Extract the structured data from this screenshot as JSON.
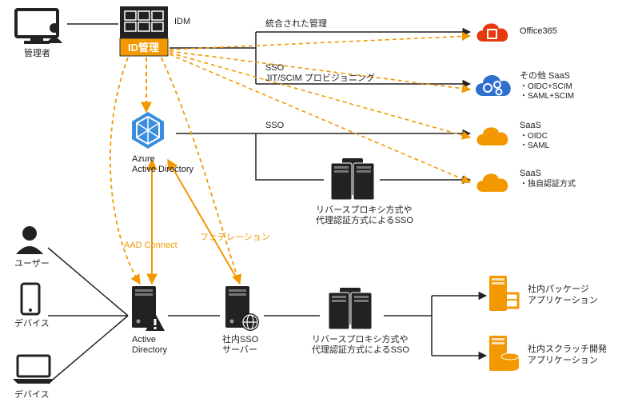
{
  "title": "IDM / ID管理 architecture diagram",
  "nodes": {
    "admin": {
      "label": "管理者"
    },
    "idm": {
      "label": "IDM"
    },
    "idmgmt": {
      "label": "ID管理"
    },
    "azuread": {
      "label1": "Azure",
      "label2": "Active Directory"
    },
    "user": {
      "label": "ユーザー"
    },
    "device1": {
      "label": "デバイス"
    },
    "device2": {
      "label": "デバイス"
    },
    "ad": {
      "label1": "Active",
      "label2": "Directory"
    },
    "ssosrv": {
      "label1": "社内SSO",
      "label2": "サーバー"
    },
    "rproxy1": {
      "label1": "リバースプロキシ方式や",
      "label2": "代理認証方式によるSSO"
    },
    "rproxy2": {
      "label1": "リバースプロキシ方式や",
      "label2": "代理認証方式によるSSO"
    },
    "o365": {
      "label": "Office365"
    },
    "othersaas": {
      "label": "その他 SaaS",
      "bullets": [
        "・OIDC+SCIM",
        "・SAML+SCIM"
      ]
    },
    "saas1": {
      "label": "SaaS",
      "bullets": [
        "・OIDC",
        "・SAML"
      ]
    },
    "saas2": {
      "label": "SaaS",
      "bullets": [
        "・独自認証方式"
      ]
    },
    "intpkg": {
      "label1": "社内パッケージ",
      "label2": "アプリケーション"
    },
    "intscratch": {
      "label1": "社内スクラッチ開発",
      "label2": "アプリケーション"
    }
  },
  "edges": {
    "integrated": "統合された管理",
    "sso": "SSO",
    "jitscim": "JIT/SCIM プロビジョニング",
    "sso2": "SSO",
    "aadconnect": "AAD Connect",
    "federation": "フェデレーション"
  }
}
